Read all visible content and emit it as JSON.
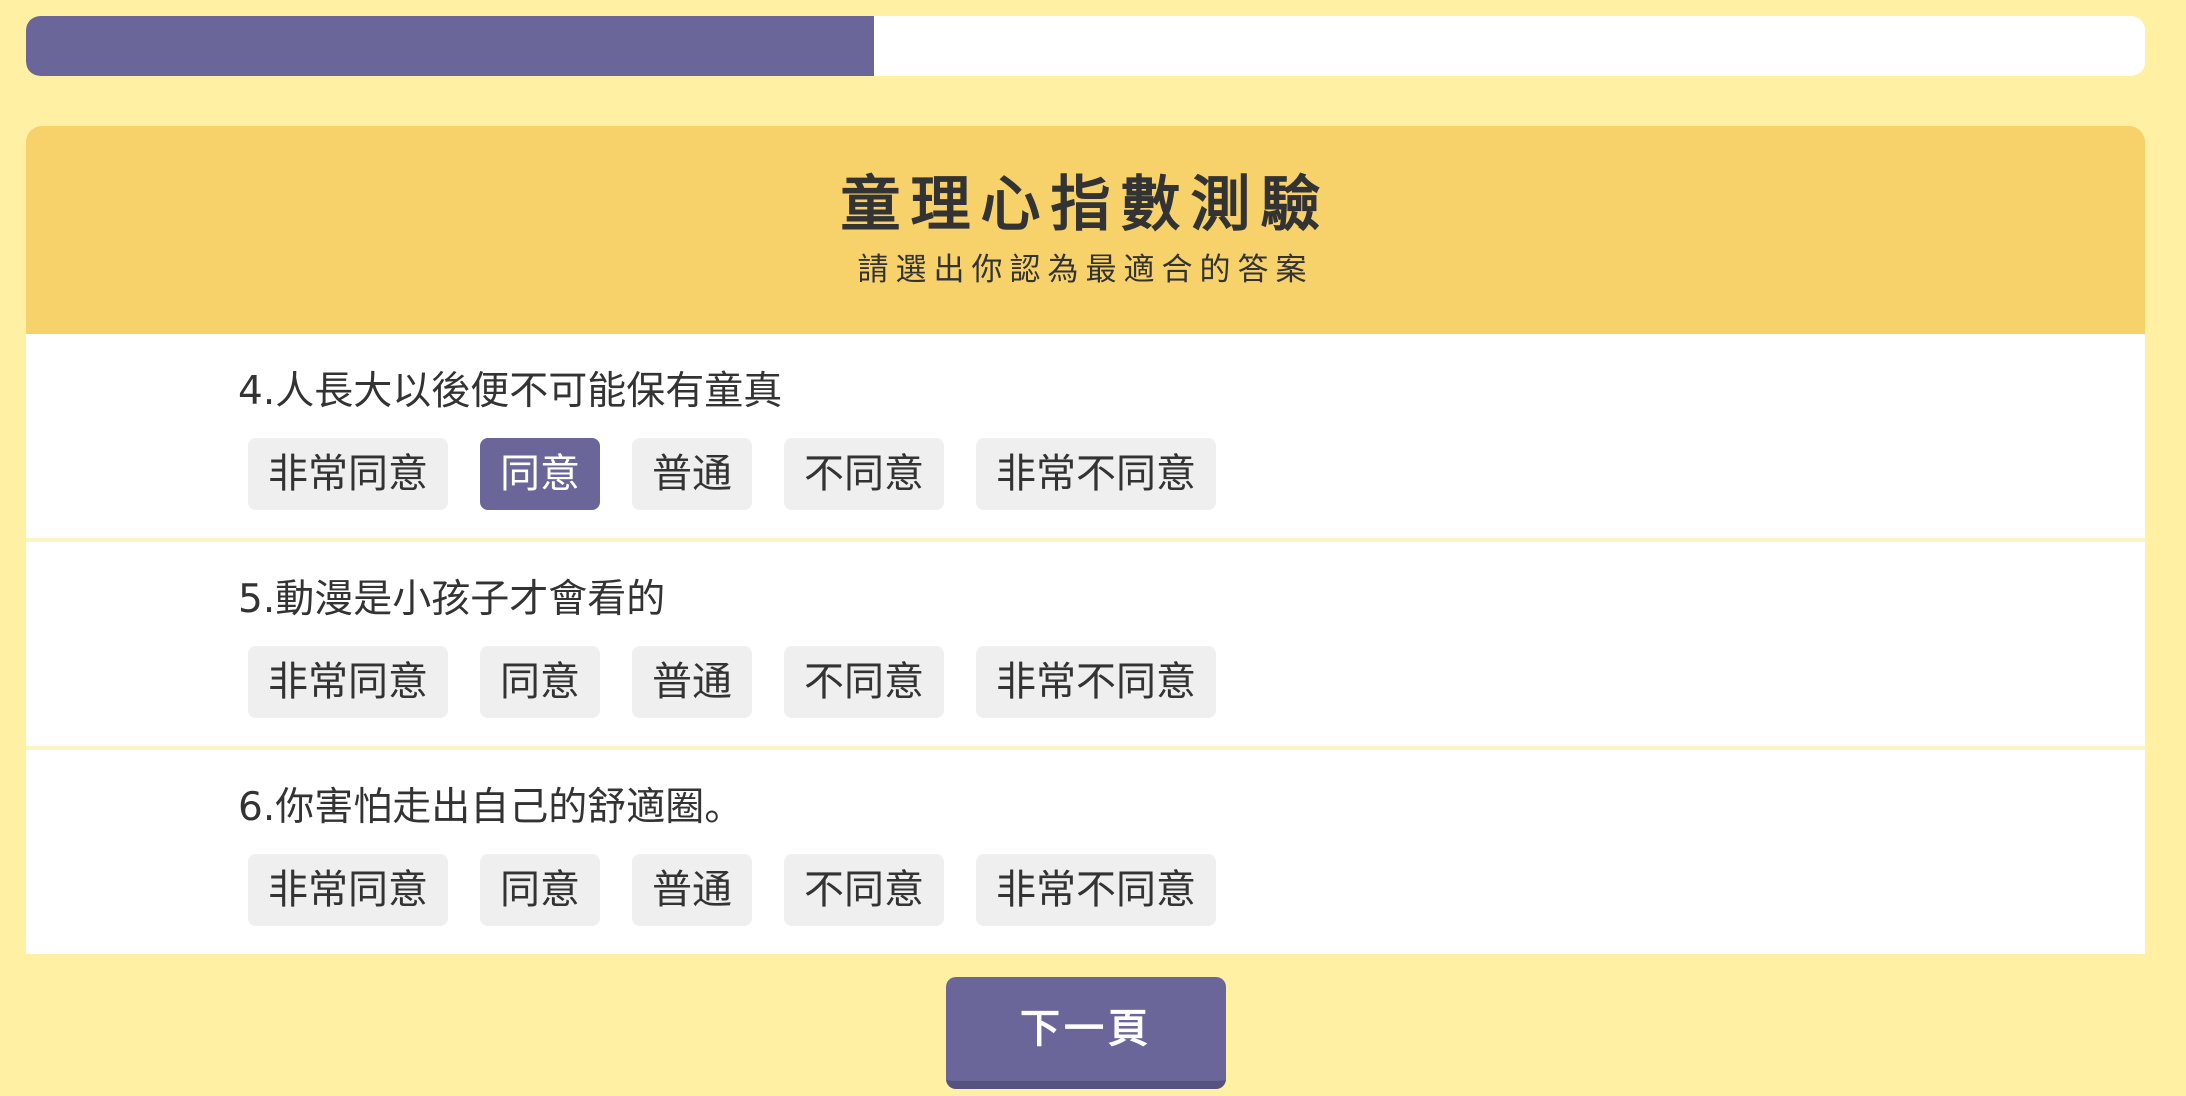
{
  "progress": {
    "value": 0.4
  },
  "header": {
    "title": "童理心指數測驗",
    "subtitle": "請選出你認為最適合的答案"
  },
  "questions": [
    {
      "text": "4.人長大以後便不可能保有童真",
      "selected": "同意",
      "options": [
        "非常同意",
        "同意",
        "普通",
        "不同意",
        "非常不同意"
      ]
    },
    {
      "text": "5.動漫是小孩子才會看的",
      "selected": null,
      "options": [
        "非常同意",
        "同意",
        "普通",
        "不同意",
        "非常不同意"
      ]
    },
    {
      "text": "6.你害怕走出自己的舒適圈。",
      "selected": null,
      "options": [
        "非常同意",
        "同意",
        "普通",
        "不同意",
        "非常不同意"
      ]
    }
  ],
  "next_button": {
    "label": "下一頁"
  },
  "colors": {
    "background": "#fff0a4",
    "header": "#f7d26b",
    "accent": "#6a6699",
    "option_bg": "#efefef"
  }
}
